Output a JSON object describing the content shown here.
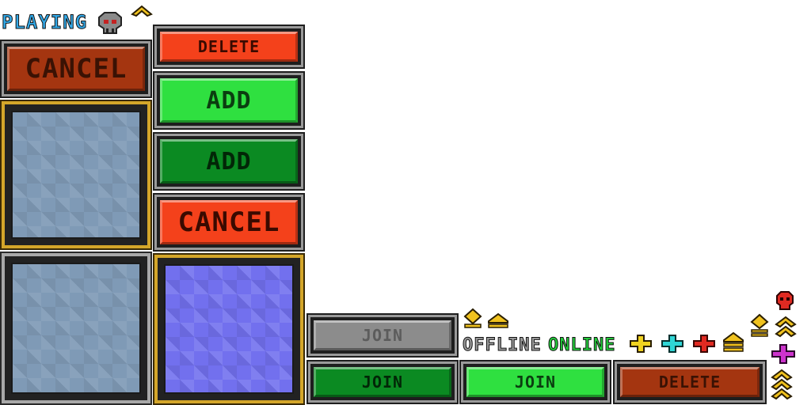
{
  "status": {
    "playing": "PLAYING",
    "offline": "OFFLINE",
    "online": "ONLINE"
  },
  "buttons": {
    "delete_top": "DELETE",
    "cancel_left": "CANCEL",
    "add_bright": "ADD",
    "add_dark": "ADD",
    "cancel_right": "CANCEL",
    "join_disabled": "JOIN",
    "join_dark": "JOIN",
    "join_bright": "JOIN",
    "delete_bottom": "DELETE"
  },
  "icons": [
    "skull-icon",
    "chevron-up-icon",
    "rank-chevron-icon",
    "rank-bar-icon",
    "yellow-plus-icon",
    "cyan-plus-icon",
    "red-plus-icon",
    "red-skull-icon",
    "magenta-plus-icon",
    "rank-triple-chevron-icon"
  ],
  "colors": {
    "playing": "#33a9e8",
    "offline": "#9a9a9a",
    "online": "#22d03a",
    "gold": "#e8c22a",
    "cyan": "#2fd6d6",
    "red": "#e02a22",
    "magenta": "#cc33cc"
  }
}
